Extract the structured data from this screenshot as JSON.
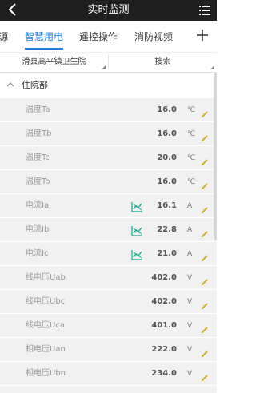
{
  "header": {
    "title": "实时监测"
  },
  "tabs": [
    {
      "label": "源",
      "active": false
    },
    {
      "label": "智慧用电",
      "active": true
    },
    {
      "label": "遥控操作",
      "active": false
    },
    {
      "label": "消防视频",
      "active": false
    }
  ],
  "filters": {
    "location": "滑县高平镇卫生院",
    "search": "搜索"
  },
  "section": {
    "label": "住院部"
  },
  "rows": [
    {
      "name": "温度Ta",
      "value": "16.0",
      "unit": "℃",
      "trend": false
    },
    {
      "name": "温度Tb",
      "value": "16.0",
      "unit": "℃",
      "trend": false
    },
    {
      "name": "温度Tc",
      "value": "20.0",
      "unit": "℃",
      "trend": false
    },
    {
      "name": "温度To",
      "value": "16.0",
      "unit": "℃",
      "trend": false
    },
    {
      "name": "电流Ia",
      "value": "16.1",
      "unit": "A",
      "trend": true
    },
    {
      "name": "电流Ib",
      "value": "22.8",
      "unit": "A",
      "trend": true
    },
    {
      "name": "电流Ic",
      "value": "21.0",
      "unit": "A",
      "trend": true
    },
    {
      "name": "线电压Uab",
      "value": "402.0",
      "unit": "V",
      "trend": false
    },
    {
      "name": "线电压Ubc",
      "value": "402.0",
      "unit": "V",
      "trend": false
    },
    {
      "name": "线电压Uca",
      "value": "401.0",
      "unit": "V",
      "trend": false
    },
    {
      "name": "相电压Uan",
      "value": "222.0",
      "unit": "V",
      "trend": false
    },
    {
      "name": "相电压Ubn",
      "value": "234.0",
      "unit": "V",
      "trend": false
    },
    {
      "name": "",
      "value": "",
      "unit": "",
      "trend": false
    }
  ],
  "colors": {
    "accent": "#1f7dd6",
    "trend_icon": "#1aa88a",
    "edit_icon": "#c9b43a",
    "row_bg": "#f1f1f1"
  },
  "icons": {
    "back": "back-arrow-icon",
    "menu": "menu-list-icon",
    "add": "plus-icon",
    "collapse": "chevron-up-icon",
    "trend": "trend-chart-icon",
    "edit": "pencil-icon"
  }
}
